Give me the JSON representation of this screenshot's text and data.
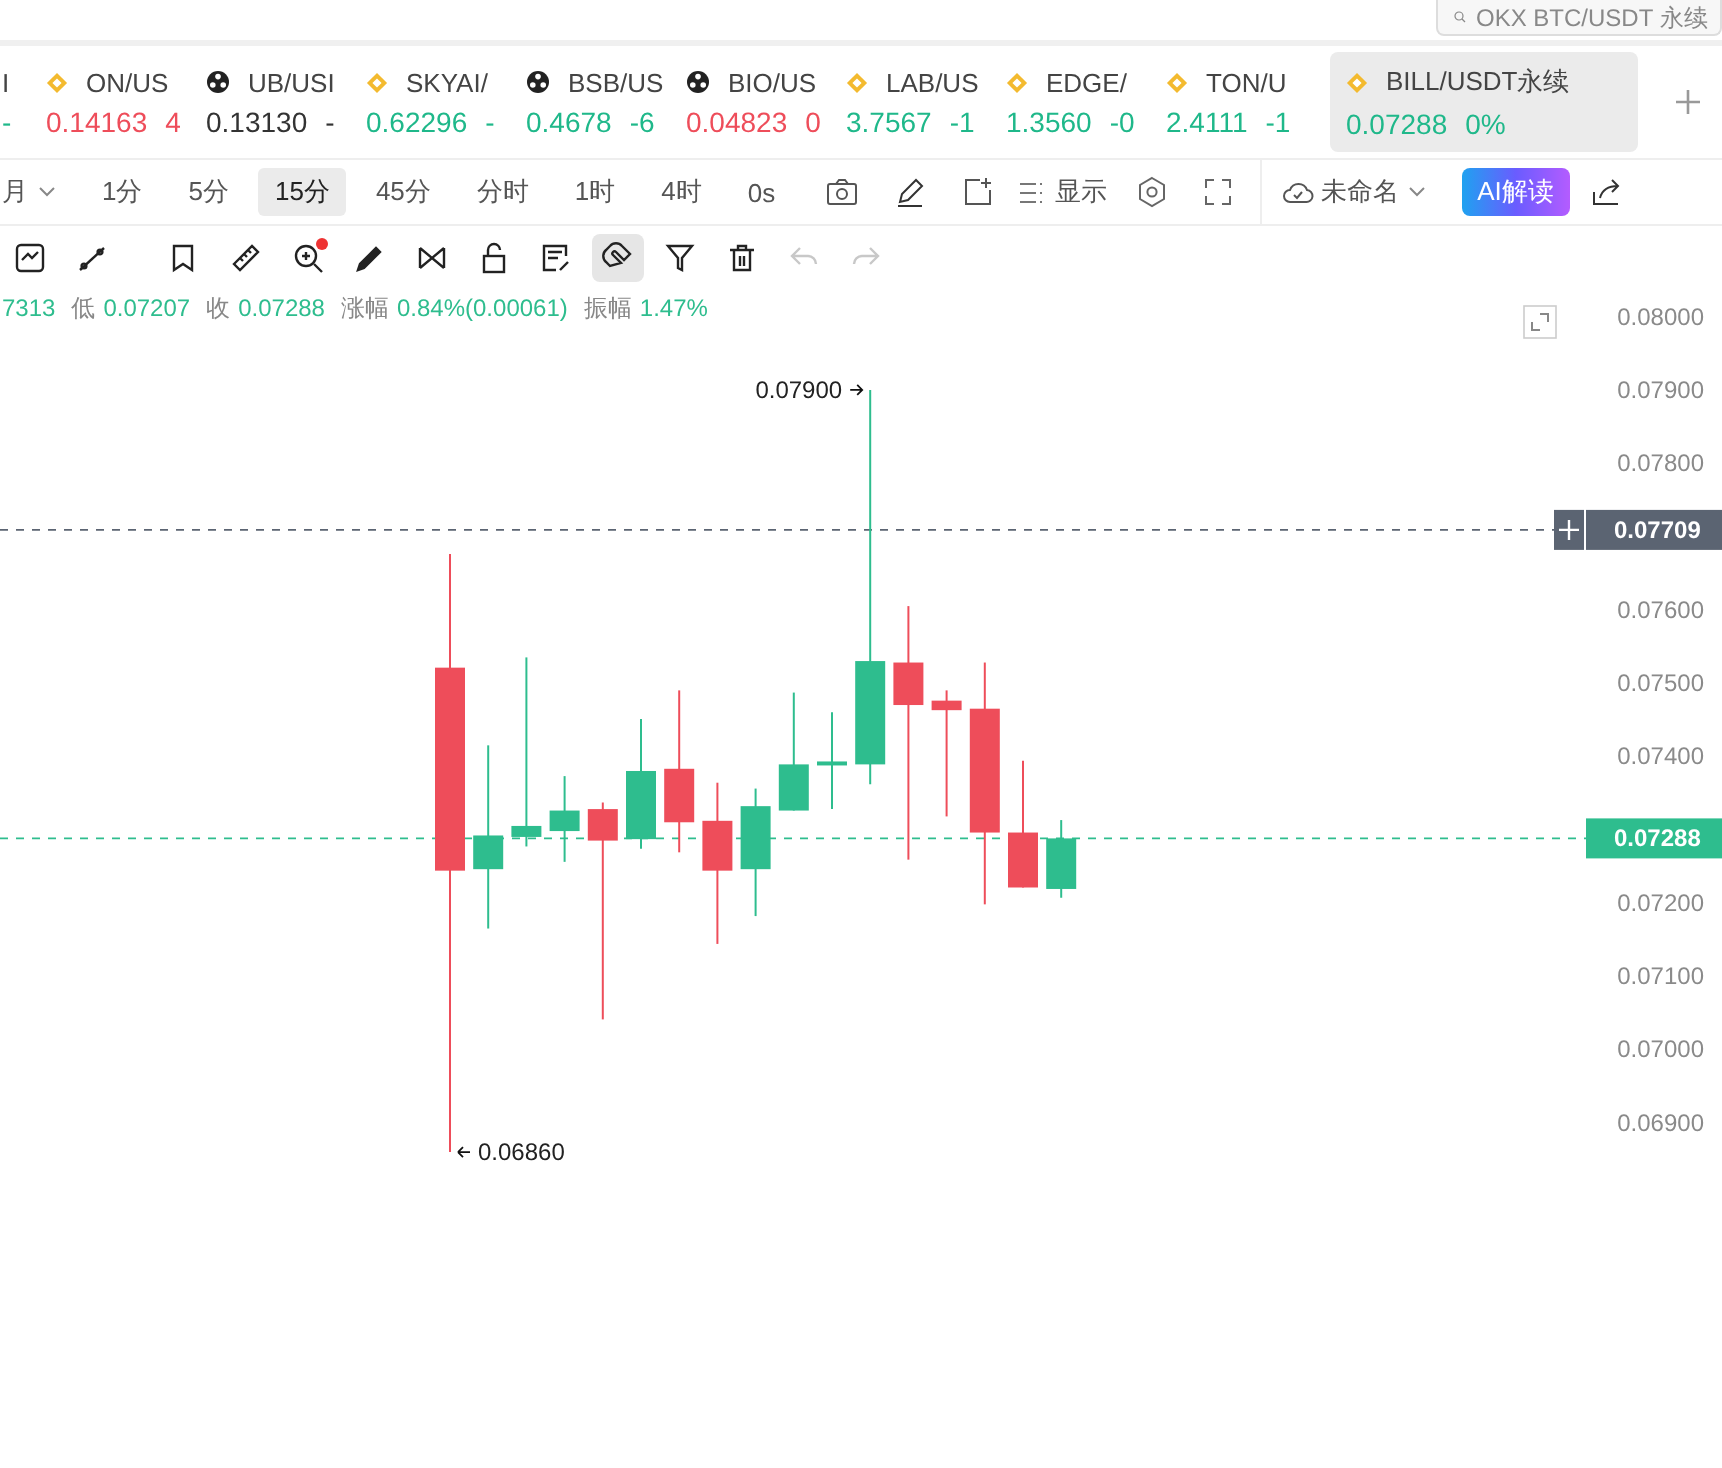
{
  "search": {
    "placeholder": "OKX BTC/USDT 永续"
  },
  "tickers": [
    {
      "symbol": "I",
      "change": "-",
      "color": "#1fb88a",
      "kind": "none",
      "selected": false
    },
    {
      "symbol": "ON/US",
      "price": "0.14163",
      "change": "4",
      "color": "#ee4d5a",
      "kind": "diamond",
      "selected": false
    },
    {
      "symbol": "UB/USI",
      "price": "0.13130",
      "change": "-",
      "color": "#333333",
      "kind": "ball",
      "selected": false
    },
    {
      "symbol": "SKYAI/",
      "price": "0.62296",
      "change": "-",
      "color": "#1fb88a",
      "kind": "diamond",
      "selected": false
    },
    {
      "symbol": "BSB/US",
      "price": "0.4678",
      "change": "-6",
      "color": "#1fb88a",
      "kind": "ball",
      "selected": false
    },
    {
      "symbol": "BIO/US",
      "price": "0.04823",
      "change": "0",
      "color": "#ee4d5a",
      "kind": "ball",
      "selected": false
    },
    {
      "symbol": "LAB/US",
      "price": "3.7567",
      "change": "-1",
      "color": "#1fb88a",
      "kind": "diamond",
      "selected": false
    },
    {
      "symbol": "EDGE/",
      "price": "1.3560",
      "change": "-0",
      "color": "#1fb88a",
      "kind": "diamond",
      "selected": false
    },
    {
      "symbol": "TON/U",
      "price": "2.4111",
      "change": "-1",
      "color": "#1fb88a",
      "kind": "diamond",
      "selected": false
    },
    {
      "symbol": "BILL/USDT永续",
      "price": "0.07288",
      "change": "0%",
      "color": "#1fb88a",
      "kind": "diamond",
      "selected": true
    }
  ],
  "intervals": [
    {
      "label": "月",
      "selected": false
    },
    {
      "label": "1分",
      "selected": false
    },
    {
      "label": "5分",
      "selected": false
    },
    {
      "label": "15分",
      "selected": true
    },
    {
      "label": "45分",
      "selected": false
    },
    {
      "label": "分时",
      "selected": false
    },
    {
      "label": "1时",
      "selected": false
    },
    {
      "label": "4时",
      "selected": false
    },
    {
      "label": "0s",
      "selected": false
    }
  ],
  "display_label": "显示",
  "layout_name": "未命名",
  "ai_button": "AI解读",
  "tools": [
    {
      "kind": "sync",
      "selected": false,
      "disabled": false,
      "badge": false
    },
    {
      "kind": "line",
      "selected": false,
      "disabled": false,
      "badge": false
    },
    {
      "kind": "bookmark",
      "selected": false,
      "disabled": false,
      "badge": false
    },
    {
      "kind": "ruler",
      "selected": false,
      "disabled": false,
      "badge": false
    },
    {
      "kind": "zoom",
      "selected": false,
      "disabled": false,
      "badge": true
    },
    {
      "kind": "pen",
      "selected": false,
      "disabled": false,
      "badge": false
    },
    {
      "kind": "pattern",
      "selected": false,
      "disabled": false,
      "badge": false
    },
    {
      "kind": "lock",
      "selected": false,
      "disabled": false,
      "badge": false
    },
    {
      "kind": "note",
      "selected": false,
      "disabled": false,
      "badge": false
    },
    {
      "kind": "magnet",
      "selected": true,
      "disabled": false,
      "badge": false
    },
    {
      "kind": "filter",
      "selected": false,
      "disabled": false,
      "badge": false
    },
    {
      "kind": "trash",
      "selected": false,
      "disabled": false,
      "badge": false
    },
    {
      "kind": "undo",
      "selected": false,
      "disabled": true,
      "badge": false
    },
    {
      "kind": "redo",
      "selected": false,
      "disabled": true,
      "badge": false
    }
  ],
  "ohlc": [
    {
      "value": "7313"
    },
    {
      "label": "低",
      "value": "0.07207"
    },
    {
      "label": "收",
      "value": "0.07288"
    },
    {
      "label": "涨幅",
      "value": "0.84%(0.00061)"
    },
    {
      "label": "振幅",
      "value": "1.47%"
    }
  ],
  "chart": {
    "price_axis": [
      "0.08000",
      "0.07900",
      "0.07800",
      "0.07600",
      "0.07500",
      "0.07400",
      "0.07200",
      "0.07100",
      "0.07000",
      "0.06900"
    ],
    "price_lines": [
      {
        "label": "0.07709",
        "kind": "crosshair"
      },
      {
        "label": "0.07288",
        "kind": "last"
      }
    ],
    "high_label": "0.07900",
    "low_label": "0.06860"
  }
}
